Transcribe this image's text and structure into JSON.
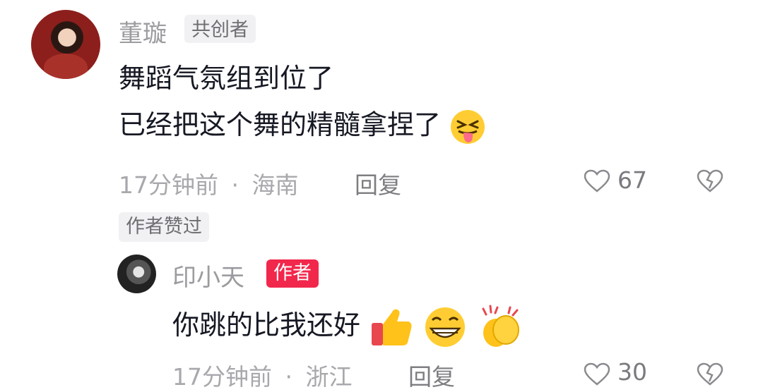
{
  "comment1": {
    "username": "董璇",
    "badge": "共创者",
    "line1": "舞蹈气氛组到位了",
    "line2": "已经把这个舞的精髓拿捏了",
    "line2_emoji": "squinting-tongue-emoji",
    "time": "17分钟前",
    "separator": "·",
    "location": "海南",
    "reply_label": "回复",
    "like_count": "67",
    "author_liked_label": "作者赞过"
  },
  "reply1": {
    "username": "印小天",
    "badge": "作者",
    "text": "你跳的比我还好",
    "emojis": [
      "thumbs-up-emoji",
      "grinning-emoji",
      "clapping-hands-emoji"
    ],
    "time": "17分钟前",
    "location": "浙江",
    "reply_label": "回复",
    "like_count": "30"
  },
  "colors": {
    "author_badge": "#f2274c",
    "text_primary": "#161823",
    "text_secondary": "#a8a8ad"
  }
}
